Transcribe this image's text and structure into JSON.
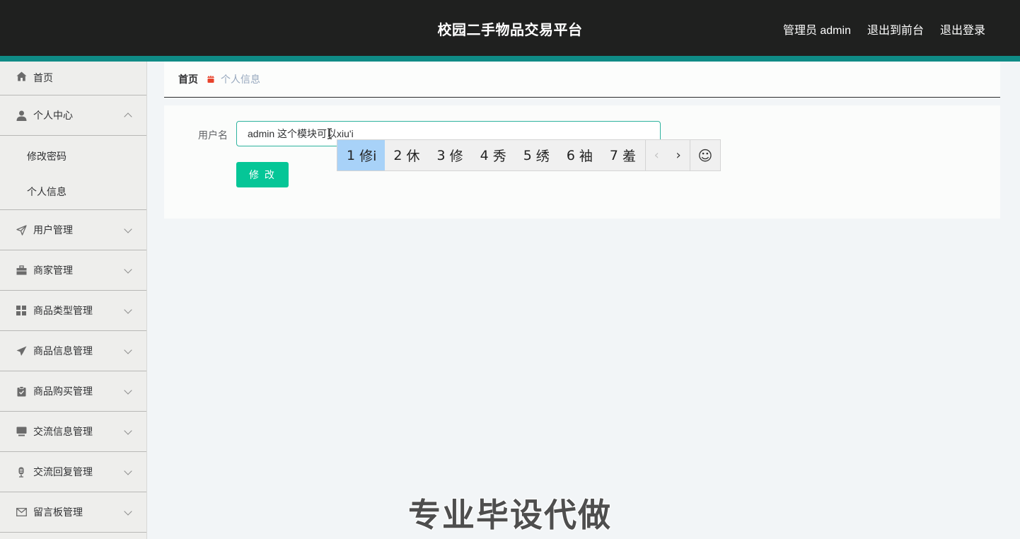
{
  "header": {
    "title": "校园二手物品交易平台",
    "admin_label": "管理员 admin",
    "frontend_link": "退出到前台",
    "logout_link": "退出登录"
  },
  "sidebar": {
    "items": [
      {
        "label": "首页",
        "icon": "home-icon"
      },
      {
        "label": "个人中心",
        "icon": "user-icon",
        "expanded": true
      },
      {
        "label": "用户管理",
        "icon": "paper-plane-outline-icon"
      },
      {
        "label": "商家管理",
        "icon": "briefcase-icon"
      },
      {
        "label": "商品类型管理",
        "icon": "grid-icon"
      },
      {
        "label": "商品信息管理",
        "icon": "send-icon"
      },
      {
        "label": "商品购买管理",
        "icon": "clipboard-check-icon"
      },
      {
        "label": "交流信息管理",
        "icon": "monitor-icon"
      },
      {
        "label": "交流回复管理",
        "icon": "microphone-icon"
      },
      {
        "label": "留言板管理",
        "icon": "envelope-icon"
      }
    ],
    "submenu": [
      "修改密码",
      "个人信息"
    ]
  },
  "breadcrumb": {
    "home": "首页",
    "current": "个人信息"
  },
  "form": {
    "username_label": "用户名",
    "username_value": "admin 这个模块可以xiu'i",
    "submit_label": "修 改"
  },
  "ime": {
    "candidates": [
      {
        "n": "1",
        "text": "修i"
      },
      {
        "n": "2",
        "text": "休"
      },
      {
        "n": "3",
        "text": "修"
      },
      {
        "n": "4",
        "text": "秀"
      },
      {
        "n": "5",
        "text": "绣"
      },
      {
        "n": "6",
        "text": "袖"
      },
      {
        "n": "7",
        "text": "羞"
      }
    ],
    "prev": "‹",
    "next": "›",
    "emoji": "☺"
  },
  "watermark": "专业毕设代做",
  "colors": {
    "header_bg": "#1f201f",
    "accent": "#0f8b86",
    "button": "#05c697",
    "sidebar_bg": "#eeeeec"
  }
}
